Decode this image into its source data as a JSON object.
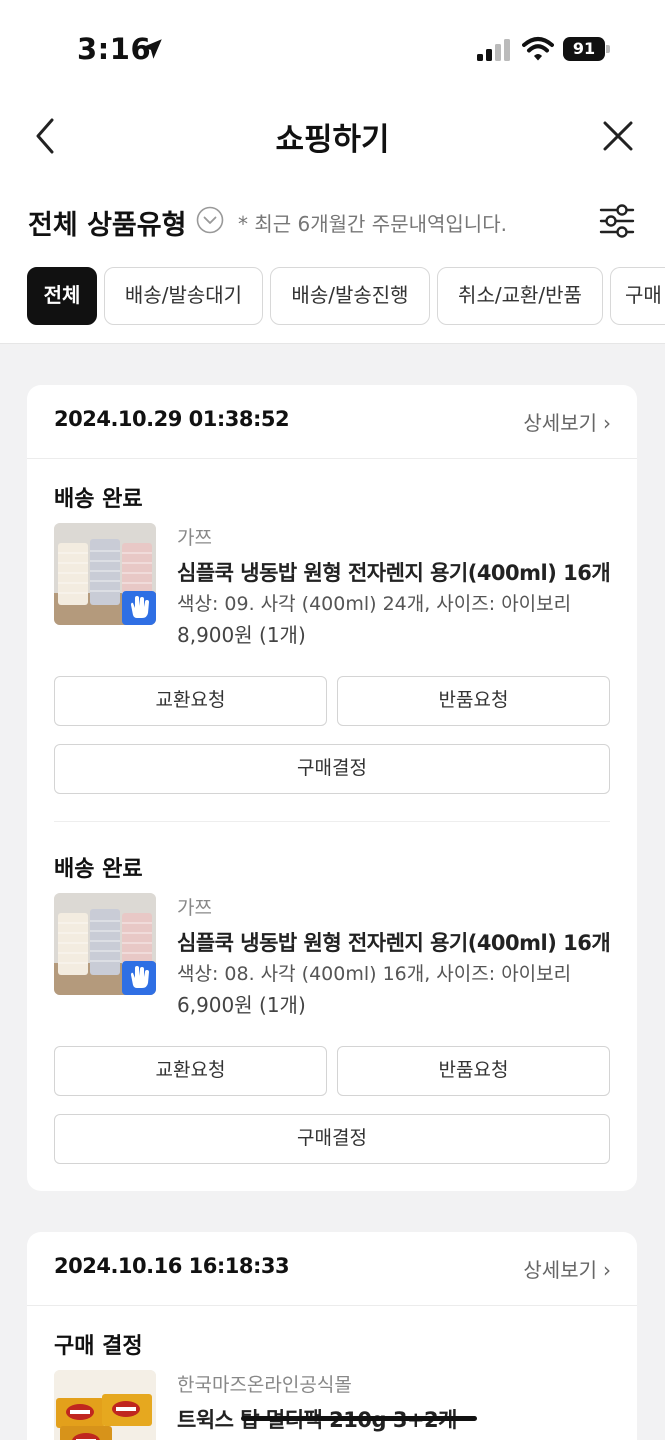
{
  "status_bar": {
    "time": "3:16",
    "battery": "91"
  },
  "header": {
    "title": "쇼핑하기"
  },
  "filter": {
    "title": "전체 상품유형",
    "note": "* 최근 6개월간 주문내역입니다."
  },
  "tabs": [
    {
      "label": "전체",
      "active": true
    },
    {
      "label": "배송/발송대기",
      "active": false
    },
    {
      "label": "배송/발송진행",
      "active": false
    },
    {
      "label": "취소/교환/반품",
      "active": false
    },
    {
      "label": "구매",
      "active": false
    }
  ],
  "orders": [
    {
      "date": "2024.10.29 01:38:52",
      "detail_label": "상세보기",
      "items": [
        {
          "status": "배송 완료",
          "seller": "가쯔",
          "name": "심플쿡 냉동밥 원형 전자렌지 용기(400ml) 16개",
          "option": "색상: 09. 사각 (400ml) 24개, 사이즈: 아이보리",
          "price": "8,900원 (1개)",
          "btn_exchange": "교환요청",
          "btn_return": "반품요청",
          "btn_confirm": "구매결정"
        },
        {
          "status": "배송 완료",
          "seller": "가쯔",
          "name": "심플쿡 냉동밥 원형 전자렌지 용기(400ml) 16개",
          "option": "색상: 08. 사각 (400ml) 16개, 사이즈: 아이보리",
          "price": "6,900원 (1개)",
          "btn_exchange": "교환요청",
          "btn_return": "반품요청",
          "btn_confirm": "구매결정"
        }
      ]
    },
    {
      "date": "2024.10.16 16:18:33",
      "detail_label": "상세보기",
      "items": [
        {
          "status": "구매 결정",
          "seller": "한국마즈온라인공식몰",
          "name": "트윅스 탑 멀티팩 210g 3+2개"
        }
      ]
    }
  ],
  "colors": {
    "accent_black": "#111111",
    "badge_blue": "#2f6fe4"
  }
}
